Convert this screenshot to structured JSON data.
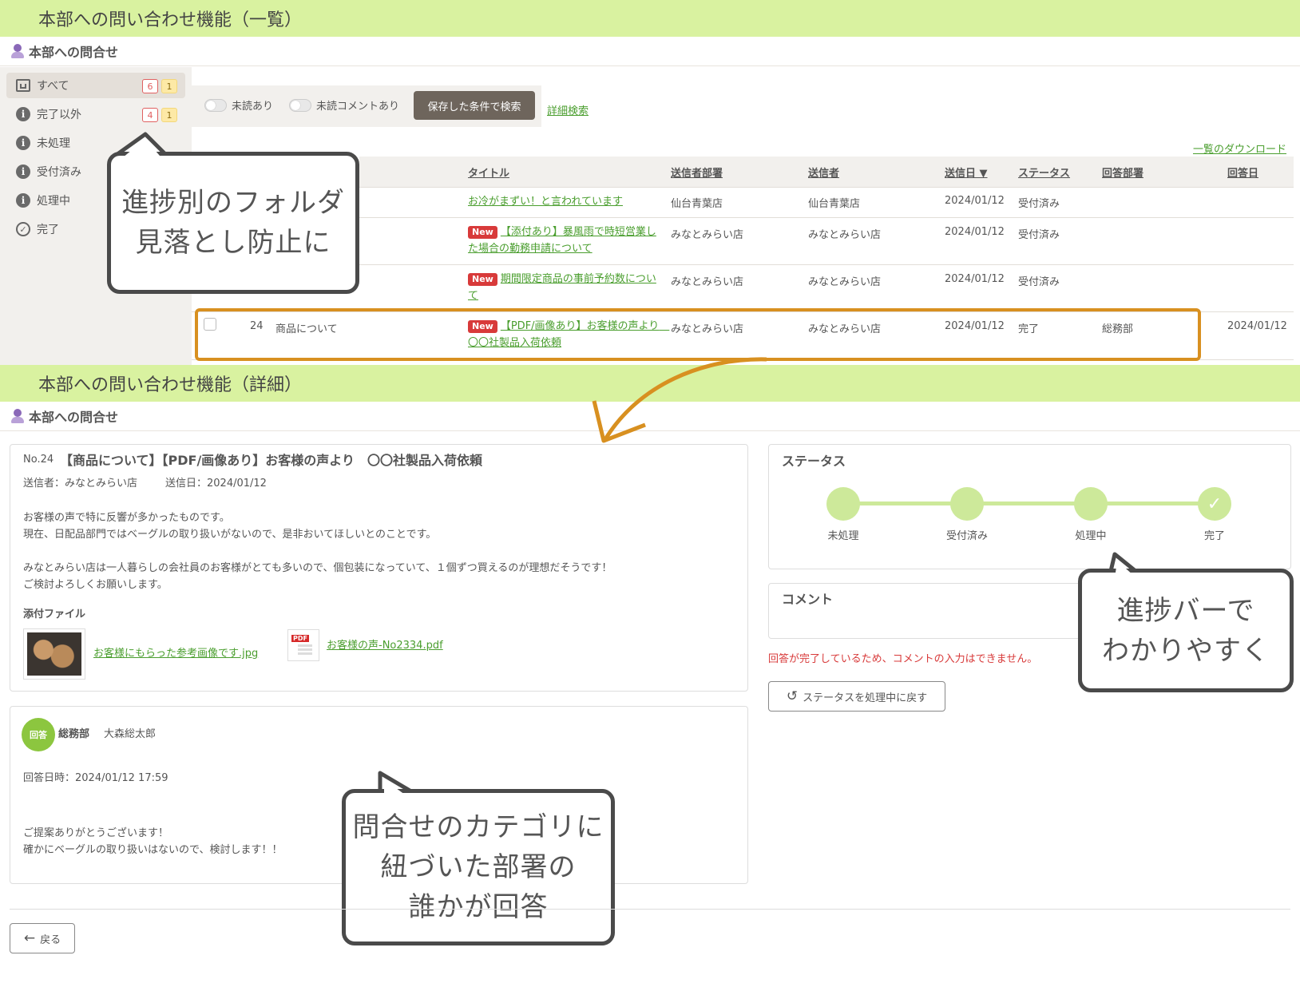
{
  "list_section": {
    "band_title": "本部への問い合わせ機能（一覧）",
    "header_title": "本部への問合せ",
    "sidebar": [
      {
        "label": "すべて",
        "icon": "inbox-icon",
        "count_red": "6",
        "count_yellow": "1"
      },
      {
        "label": "完了以外",
        "icon": "info-icon",
        "count_red": "4",
        "count_yellow": "1"
      },
      {
        "label": "未処理",
        "icon": "info-icon"
      },
      {
        "label": "受付済み",
        "icon": "info-icon"
      },
      {
        "label": "処理中",
        "icon": "info-icon"
      },
      {
        "label": "完了",
        "icon": "check-circle-icon"
      }
    ],
    "filters": {
      "unread": "未読あり",
      "unread_comment": "未読コメントあり",
      "saved_search": "保存した条件で検索",
      "advanced_search": "詳細検索",
      "download": "一覧のダウンロード"
    },
    "columns": [
      "タイトル",
      "送信者部署",
      "送信者",
      "送信日 ▼",
      "ステータス",
      "回答部署",
      "回答日"
    ],
    "new_label": "New",
    "rows": [
      {
        "no": "",
        "category": "",
        "title": "お冷がまずい！と言われています",
        "dept": "仙台青葉店",
        "sender": "仙台青葉店",
        "date": "2024/01/12",
        "status": "受付済み",
        "answer_dept": "",
        "answer_date": ""
      },
      {
        "no": "",
        "category": "",
        "title": "【添付あり】暴風雨で時短営業した場合の勤務申請について",
        "dept": "みなとみらい店",
        "sender": "みなとみらい店",
        "date": "2024/01/12",
        "status": "受付済み",
        "answer_dept": "",
        "answer_date": ""
      },
      {
        "no": "",
        "category": "",
        "title": "期間限定商品の事前予約数について",
        "dept": "みなとみらい店",
        "sender": "みなとみらい店",
        "date": "2024/01/12",
        "status": "受付済み",
        "answer_dept": "",
        "answer_date": ""
      },
      {
        "no": "24",
        "category": "商品について",
        "title": "【PDF/画像あり】お客様の声より　〇〇社製品入荷依頼",
        "dept": "みなとみらい店",
        "sender": "みなとみらい店",
        "date": "2024/01/12",
        "status": "完了",
        "answer_dept": "総務部",
        "answer_date": "2024/01/12"
      }
    ]
  },
  "detail_section": {
    "band_title": "本部への問い合わせ機能（詳細）",
    "header_title": "本部への問合せ",
    "inquiry": {
      "no": "No.24",
      "title": "【商品について】【PDF/画像あり】お客様の声より　〇〇社製品入荷依頼",
      "sender": "送信者：みなとみらい店",
      "sent_date": "送信日：2024/01/12",
      "body_1": "お客様の声で特に反響が多かったものです。",
      "body_2": "現在、日配品部門ではベーグルの取り扱いがないので、是非おいてほしいとのことです。",
      "body_3": "みなとみらい店は一人暮らしの会社員のお客様がとても多いので、個包装になっていて、１個ずつ買えるのが理想だそうです！",
      "body_4": "ご検討よろしくお願いします。",
      "attachments_label": "添付ファイル",
      "attachment_image": "お客様にもらった参考画像です.jpg",
      "attachment_pdf": "お客様の声-No2334.pdf",
      "pdf_badge": "PDF"
    },
    "answer": {
      "badge": "回答",
      "dept": "総務部",
      "name": "大森総太郎",
      "datetime": "回答日時：2024/01/12 17:59",
      "body_1": "ご提案ありがとうございます！",
      "body_2": "確かにベーグルの取り扱いはないので、検討します！！"
    },
    "status_panel": {
      "title": "ステータス",
      "steps": [
        "未処理",
        "受付済み",
        "処理中",
        "完了"
      ],
      "current_step": 4
    },
    "comment_panel": {
      "title": "コメント",
      "notice": "回答が完了しているため、コメントの入力はできません。",
      "revert_button": "ステータスを処理中に戻す"
    },
    "back_button": "戻る"
  },
  "callouts": {
    "folders_1": "進捗別のフォルダ",
    "folders_2": "見落とし防止に",
    "progress_1": "進捗バーで",
    "progress_2": "わかりやすく",
    "answer_1": "問合せのカテゴリに",
    "answer_2": "紐づいた部署の",
    "answer_3": "誰かが回答"
  },
  "colors": {
    "band": "#d9f2a0",
    "link": "#4a9e2e",
    "highlight": "#d89020",
    "new_badge": "#d83a3a",
    "progress": "#cde99a",
    "notice": "#d83a3a"
  }
}
